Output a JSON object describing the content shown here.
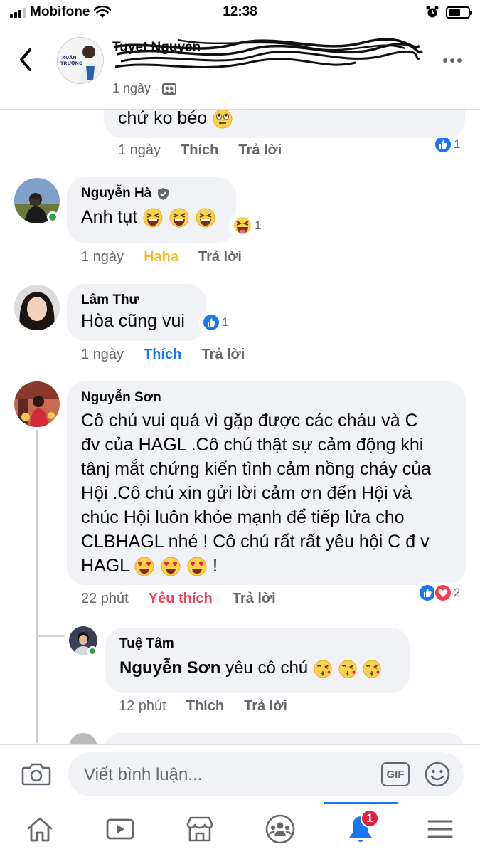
{
  "status_bar": {
    "carrier": "Mobifone",
    "time": "12:38"
  },
  "header": {
    "title": "Tuyet Nguyen",
    "time": "1 ngày",
    "avatar_caption": "XUÂN TRƯỜNG"
  },
  "comments": [
    {
      "text": "chứ ko béo",
      "time": "1 ngày",
      "action_label": "Thích",
      "reply_label": "Trả lời",
      "reaction_count": "1"
    },
    {
      "author": "Nguyễn Hà",
      "text": "Anh tụt",
      "time": "1 ngày",
      "action_label": "Haha",
      "reply_label": "Trả lời",
      "reaction_count": "1"
    },
    {
      "author": "Lâm Thư",
      "text": "Hòa cũng vui",
      "time": "1 ngày",
      "action_label": "Thích",
      "reply_label": "Trả lời",
      "reaction_count": "1"
    },
    {
      "author": "Nguyễn Sơn",
      "lines": [
        "Cô chú vui quá vì gặp được các cháu và C",
        "đv của HAGL .Cô chú thật sự cảm động khi",
        "tânj mắt chứng kiến tình cảm nồng cháy của",
        "Hội .Cô chú xin gửi lời cảm ơn đến Hội và",
        "chúc Hội luôn khỏe mạnh để tiếp lửa cho",
        "CLBHAGL nhé ! Cô chú rất rất yêu hội C đ v",
        "HAGL"
      ],
      "text_end": "!",
      "time": "22 phút",
      "action_label": "Yêu thích",
      "reply_label": "Trả lời",
      "reaction_count": "2"
    },
    {
      "author": "Tuệ Tâm",
      "mention": "Nguyễn Sơn",
      "text": "yêu cô chú",
      "time": "12 phút",
      "action_label": "Thích",
      "reply_label": "Trả lời"
    }
  ],
  "composer": {
    "placeholder": "Viết bình luận...",
    "gif_label": "GIF"
  },
  "tabbar": {
    "notification_badge": "1"
  },
  "colors": {
    "accent": "#1877f2",
    "haha": "#f7b928",
    "love": "#f33e58",
    "bubble": "#f0f2f5",
    "badge": "#e41e3f"
  },
  "icons": [
    "back-icon",
    "more-icon",
    "friends-icon",
    "camera-icon",
    "gif-icon",
    "sticker-icon",
    "home-icon",
    "video-icon",
    "marketplace-icon",
    "groups-icon",
    "bell-icon",
    "menu-icon"
  ]
}
